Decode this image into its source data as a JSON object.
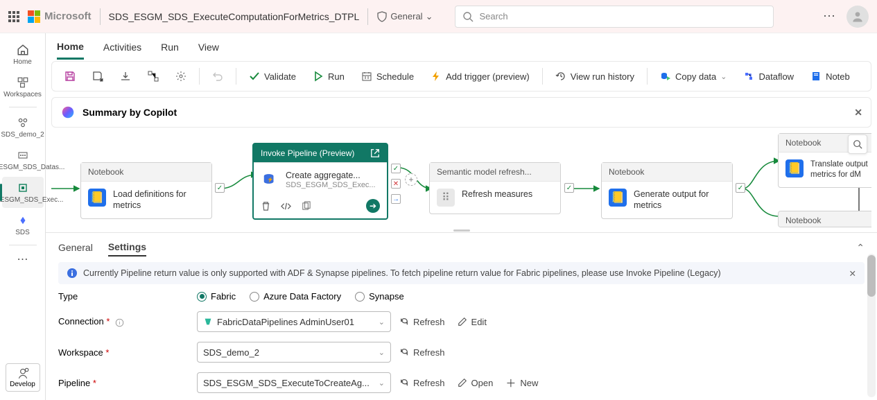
{
  "top": {
    "ms": "Microsoft",
    "title": "SDS_ESGM_SDS_ExecuteComputationForMetrics_DTPL",
    "sensitivity": "General",
    "search_placeholder": "Search"
  },
  "rail": {
    "home": "Home",
    "workspaces": "Workspaces",
    "ws1": "SDS_demo_2",
    "ws2": "SDS_ESGM_SDS_Datas...",
    "ws3": "SDS_ESGM_SDS_Exec...",
    "ws4": "SDS",
    "develop": "Develop"
  },
  "tabs": {
    "home": "Home",
    "activities": "Activities",
    "run": "Run",
    "view": "View"
  },
  "toolbar": {
    "validate": "Validate",
    "run": "Run",
    "schedule": "Schedule",
    "addTrigger": "Add trigger (preview)",
    "history": "View run history",
    "copy": "Copy data",
    "dataflow": "Dataflow",
    "notebook": "Noteb"
  },
  "copilot": {
    "title": "Summary by Copilot"
  },
  "canvas": {
    "n1": {
      "type": "Notebook",
      "title": "Load definitions for metrics"
    },
    "n2": {
      "type": "Invoke Pipeline (Preview)",
      "title": "Create aggregate...",
      "sub": "SDS_ESGM_SDS_Exec..."
    },
    "n3": {
      "type": "Semantic model refresh...",
      "title": "Refresh measures"
    },
    "n4": {
      "type": "Notebook",
      "title": "Generate output for metrics"
    },
    "n5": {
      "type": "Notebook",
      "title": "Translate output metrics for dM"
    },
    "n6": {
      "type": "Notebook"
    }
  },
  "panel": {
    "tabs": {
      "general": "General",
      "settings": "Settings"
    },
    "info": "Currently Pipeline return value is only supported with ADF & Synapse pipelines. To fetch pipeline return value for Fabric pipelines, please use Invoke Pipeline (Legacy)",
    "labels": {
      "type": "Type",
      "connection": "Connection",
      "workspace": "Workspace",
      "pipeline": "Pipeline"
    },
    "typeOptions": {
      "fabric": "Fabric",
      "adf": "Azure Data Factory",
      "synapse": "Synapse"
    },
    "connection": "FabricDataPipelines AdminUser01",
    "workspace": "SDS_demo_2",
    "pipeline": "SDS_ESGM_SDS_ExecuteToCreateAg...",
    "actions": {
      "refresh": "Refresh",
      "edit": "Edit",
      "open": "Open",
      "new": "New"
    }
  }
}
